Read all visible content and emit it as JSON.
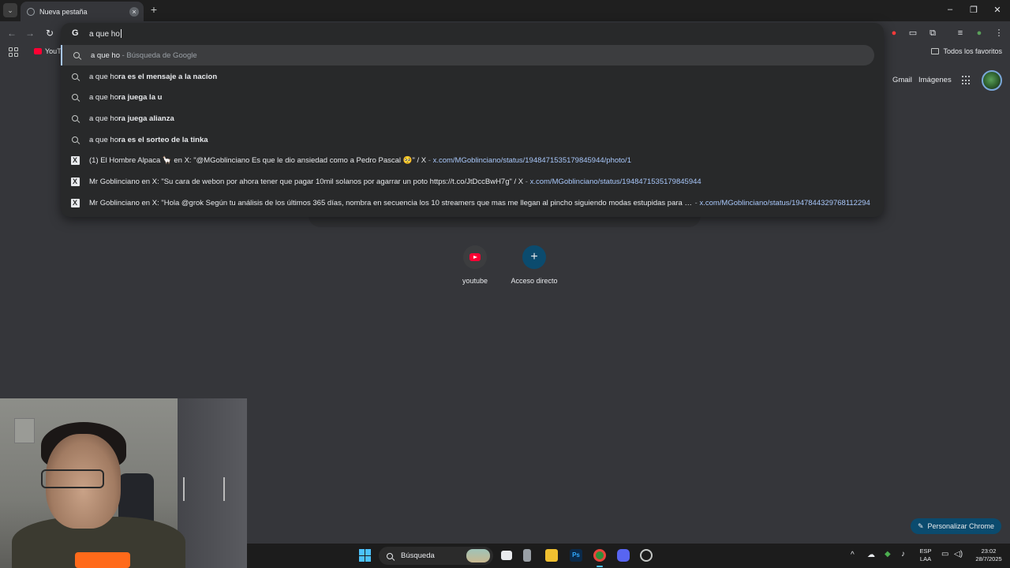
{
  "browser": {
    "tab_title": "Nueva pestaña",
    "address_text": "a que ho"
  },
  "bookmarks": {
    "youtube_label": "YouTube",
    "all_bookmarks_label": "Todos los favoritos"
  },
  "omnibox": {
    "suggestions": [
      {
        "prefix": "a que ho",
        "bold": "",
        "suffix": "",
        "muted": " - Búsqueda de Google",
        "link": ""
      },
      {
        "prefix": "a que ho",
        "bold": "ra es el mensaje a la nacion",
        "suffix": "",
        "muted": "",
        "link": ""
      },
      {
        "prefix": "a que ho",
        "bold": "ra juega la u",
        "suffix": "",
        "muted": "",
        "link": ""
      },
      {
        "prefix": "a que ho",
        "bold": "ra juega alianza",
        "suffix": "",
        "muted": "",
        "link": ""
      },
      {
        "prefix": "a que ho",
        "bold": "ra es el sorteo de la tinka",
        "suffix": "",
        "muted": "",
        "link": ""
      },
      {
        "text": "(1) El Hombre Alpaca 🦙 en X: \"@MGoblinciano Es que le dio ansiedad como a Pedro Pascal 🥺\" / X",
        "link": "x.com/MGoblinciano/status/1948471535179845944/photo/1"
      },
      {
        "text": "Mr Goblinciano en X: \"Su cara de webon por ahora tener que pagar 10mil solanos por agarrar un poto https://t.co/JtDccBwH7g\" / X",
        "link": "x.com/MGoblinciano/status/1948471535179845944"
      },
      {
        "text": "Mr Goblinciano en X: \"Hola @grok Según tu análisis de los últimos 365 días, nombra en secuencia los 10 streamers que mas me llegan al pincho siguiendo modas estupidas para llamar...",
        "link": "x.com/MGoblinciano/status/1947844329768112294"
      }
    ]
  },
  "ntp": {
    "gmail": "Gmail",
    "images": "Imágenes",
    "shortcuts": [
      "youtube",
      "Acceso directo"
    ],
    "customize": "Personalizar Chrome"
  },
  "taskbar": {
    "search_label": "Búsqueda",
    "lang_top": "ESP",
    "lang_bottom": "LAA",
    "time": "23:02",
    "date": "28/7/2025"
  },
  "colors": {
    "accent": "#a8c7fa",
    "customize_bg": "#0b4b6e"
  }
}
